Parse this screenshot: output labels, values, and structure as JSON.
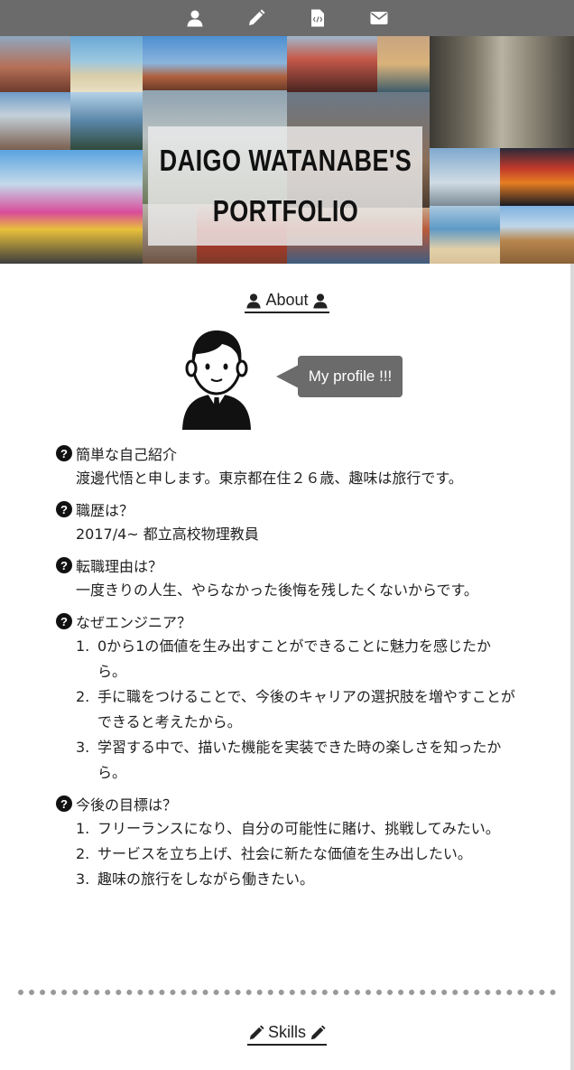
{
  "nav": {
    "icons": [
      "user-icon",
      "pencil-icon",
      "code-file-icon",
      "envelope-icon"
    ],
    "bg_color": "#6b6b6b"
  },
  "hero": {
    "title_line1": "DAIGO WATANABE'S",
    "title_line2": "PORTFOLIO"
  },
  "about": {
    "heading": "About",
    "bubble": "My profile !!!",
    "items": [
      {
        "question": "簡単な自己紹介",
        "answer": "渡邊代悟と申します。東京都在住２６歳、趣味は旅行です。"
      },
      {
        "question": "職歴は？",
        "answer": "2017/4~ 都立高校物理教員"
      },
      {
        "question": "転職理由は？",
        "answer": "一度きりの人生、やらなかった後悔を残したくないからです。"
      },
      {
        "question": "なぜエンジニア？",
        "list": [
          "0から1の価値を生み出すことができることに魅力を感じたから。",
          "手に職をつけることで、今後のキャリアの選択肢を増やすことができると考えたから。",
          "学習する中で、描いた機能を実装できた時の楽しさを知ったから。"
        ]
      },
      {
        "question": "今後の目標は？",
        "list": [
          "フリーランスになり、自分の可能性に賭け、挑戦してみたい。",
          "サービスを立ち上げ、社会に新たな価値を生み出したい。",
          "趣味の旅行をしながら働きたい。"
        ]
      }
    ]
  },
  "skills": {
    "heading": "Skills"
  }
}
